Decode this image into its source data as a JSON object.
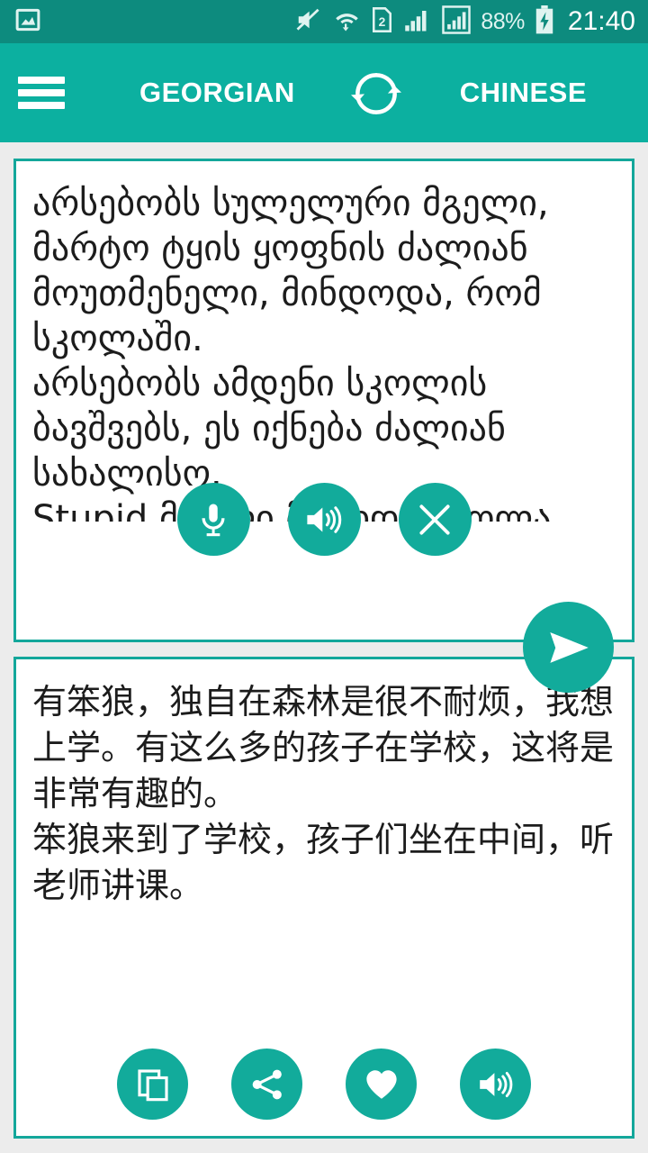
{
  "status_bar": {
    "icons": [
      "screenshot-image-icon",
      "volume-mute-icon",
      "wifi-data-icon",
      "sim2-icon",
      "signal-1-icon",
      "signal-2-icon"
    ],
    "battery_percent": "88%",
    "battery_state": "charging",
    "clock": "21:40",
    "background_color": "#0d8b7e"
  },
  "app_bar": {
    "menu_label": "menu",
    "source_language": "GEORGIAN",
    "target_language": "CHINESE",
    "swap_label": "swap-languages",
    "background_color": "#0cb0a0"
  },
  "source_card": {
    "text": "არსებობს სულელური მგელი, მარტო ტყის ყოფნის ძალიან მოუთმენელი, მინდოდა, რომ სკოლაში.\nარსებობს ამდენი სკოლის ბავშვებს, ეს იქნება ძალიან სახალისო.\nStupid მგელი მოვიდა სკოლა, ბავშვეიბ იჯდა შუა,",
    "buttons": [
      {
        "name": "microphone-button",
        "label": "Voice input"
      },
      {
        "name": "speak-button",
        "label": "Speak"
      },
      {
        "name": "clear-button",
        "label": "Clear"
      }
    ]
  },
  "send_button": {
    "label": "Translate",
    "icon": "send-icon"
  },
  "target_card": {
    "text": "有笨狼，独自在森林是很不耐烦，我想上学。有这么多的孩子在学校，这将是非常有趣的。\n笨狼来到了学校，孩子们坐在中间，听老师讲课。",
    "buttons": [
      {
        "name": "copy-button",
        "label": "Copy"
      },
      {
        "name": "share-button",
        "label": "Share"
      },
      {
        "name": "favorite-button",
        "label": "Favorite"
      },
      {
        "name": "speak-button",
        "label": "Speak"
      }
    ]
  },
  "theme": {
    "accent": "#0cb0a0",
    "accent_dark": "#0d8b7e",
    "card_border": "#13a79b",
    "fab": "#12ab9b",
    "page_background": "#ececec",
    "text": "#1c1c1c"
  }
}
